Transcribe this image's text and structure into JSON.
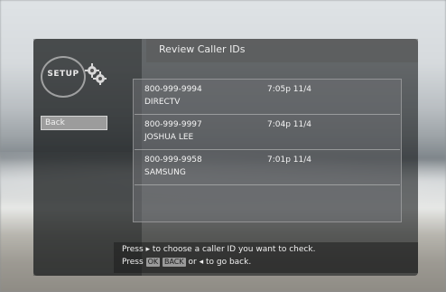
{
  "screen": {
    "setup_label": "SETUP",
    "title": "Review Caller IDs",
    "back_label": "Back"
  },
  "calls": [
    {
      "number": "800-999-9994",
      "time": "7:05p 11/4",
      "name": "DIRECTV"
    },
    {
      "number": "800-999-9997",
      "time": "7:04p 11/4",
      "name": "JOSHUA LEE"
    },
    {
      "number": "800-999-9958",
      "time": "7:01p 11/4",
      "name": "SAMSUNG"
    }
  ],
  "hint": {
    "line1": "Press ▸ to choose a caller ID you want to check.",
    "line2_prefix": "Press",
    "key_ok": "OK",
    "key_back": "BACK",
    "line2_suffix": "or ◂ to go back."
  },
  "icons": {
    "setup_badge": "setup-ring-icon",
    "gear": "gear-icon"
  }
}
